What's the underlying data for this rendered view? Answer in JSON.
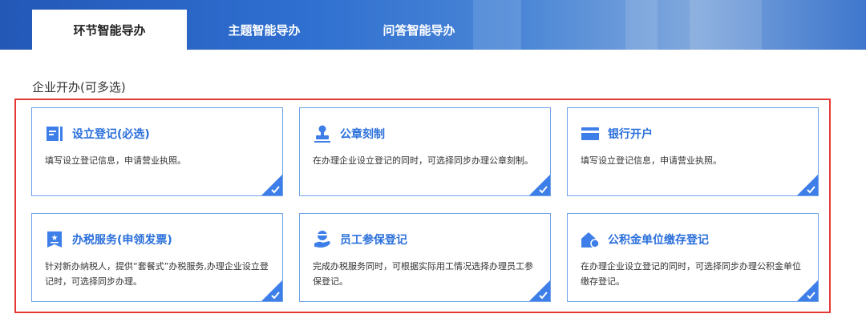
{
  "tabs": [
    {
      "label": "环节智能导办",
      "active": true
    },
    {
      "label": "主题智能导办",
      "active": false
    },
    {
      "label": "问答智能导办",
      "active": false
    }
  ],
  "section": {
    "title": "企业开办(可多选)"
  },
  "cards": [
    {
      "icon": "form-icon",
      "title": "设立登记(必选)",
      "desc": "填写设立登记信息，申请营业执照。"
    },
    {
      "icon": "stamp-icon",
      "title": "公章刻制",
      "desc": "在办理企业设立登记的同时，可选择同步办理公章刻制。"
    },
    {
      "icon": "bank-card-icon",
      "title": "银行开户",
      "desc": "填写设立登记信息，申请营业执照。"
    },
    {
      "icon": "tax-invoice-icon",
      "title": "办税服务(申领发票)",
      "desc": "针对新办纳税人，提供“套餐式”办税服务,办理企业设立登记时，可选择同步办理。"
    },
    {
      "icon": "employee-insurance-icon",
      "title": "员工参保登记",
      "desc": "完成办税服务同时，可根据实际用工情况选择办理员工参保登记。"
    },
    {
      "icon": "housing-fund-icon",
      "title": "公积金单位缴存登记",
      "desc": "在办理企业设立登记的同时，可选择同步办理公积金单位缴存登记。"
    }
  ],
  "colors": {
    "accent": "#2a6fdb",
    "icon": "#3d7ee8",
    "highlight_border": "#e53935"
  }
}
